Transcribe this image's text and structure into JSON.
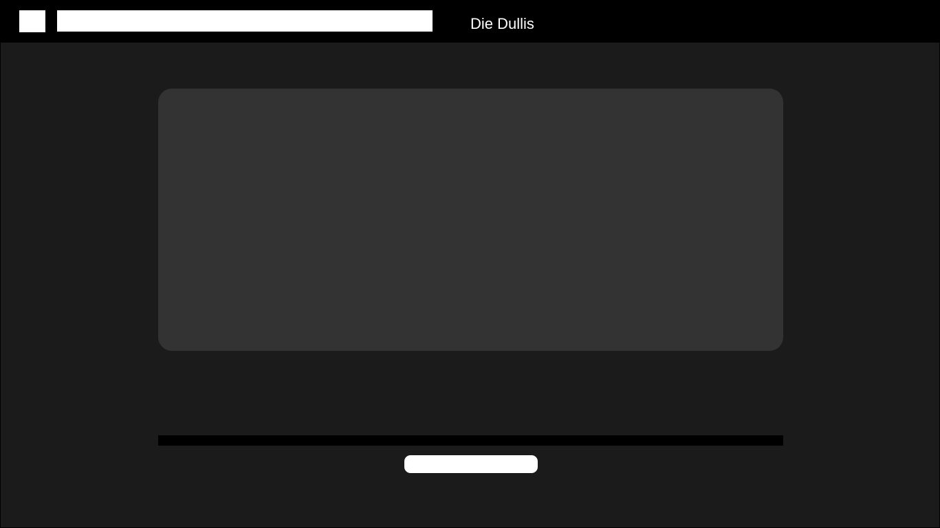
{
  "header": {
    "brand_title": "Die Dullis",
    "search_value": "",
    "menu_icon": "menu-icon"
  },
  "main": {
    "action_button_label": ""
  },
  "colors": {
    "background": "#1b1b1b",
    "header": "#000000",
    "panel": "#333333",
    "placeholder_white": "#ffffff"
  }
}
